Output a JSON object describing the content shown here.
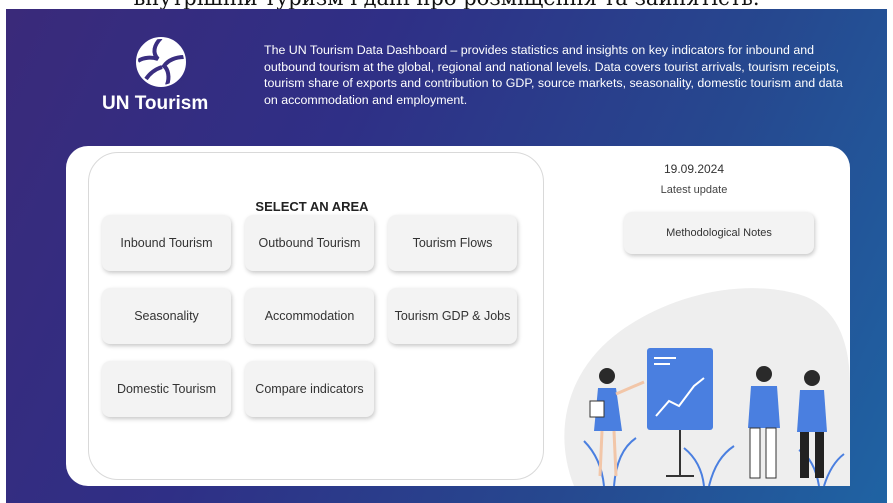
{
  "caption": "внутрішній туризм і дані про розміщення та зайнятість.",
  "brand": {
    "name": "UN Tourism"
  },
  "description": "The UN Tourism Data Dashboard – provides statistics and insights on key indicators for inbound and outbound tourism at the global, regional and national levels. Data covers tourist arrivals, tourism receipts, tourism share of exports and contribution to GDP, source markets, seasonality, domestic tourism and data on accommodation and employment.",
  "areas": {
    "title": "SELECT AN AREA",
    "items": [
      "Inbound Tourism",
      "Outbound Tourism",
      "Tourism Flows",
      "Seasonality",
      "Accommodation",
      "Tourism GDP & Jobs",
      "Domestic Tourism",
      "Compare indicators"
    ]
  },
  "update": {
    "date": "19.09.2024",
    "label": "Latest update"
  },
  "methodology": {
    "label": "Methodological Notes"
  },
  "colors": {
    "bg_start": "#3a2a7a",
    "bg_end": "#1f63a3",
    "accent_blue": "#4a7fe0"
  }
}
